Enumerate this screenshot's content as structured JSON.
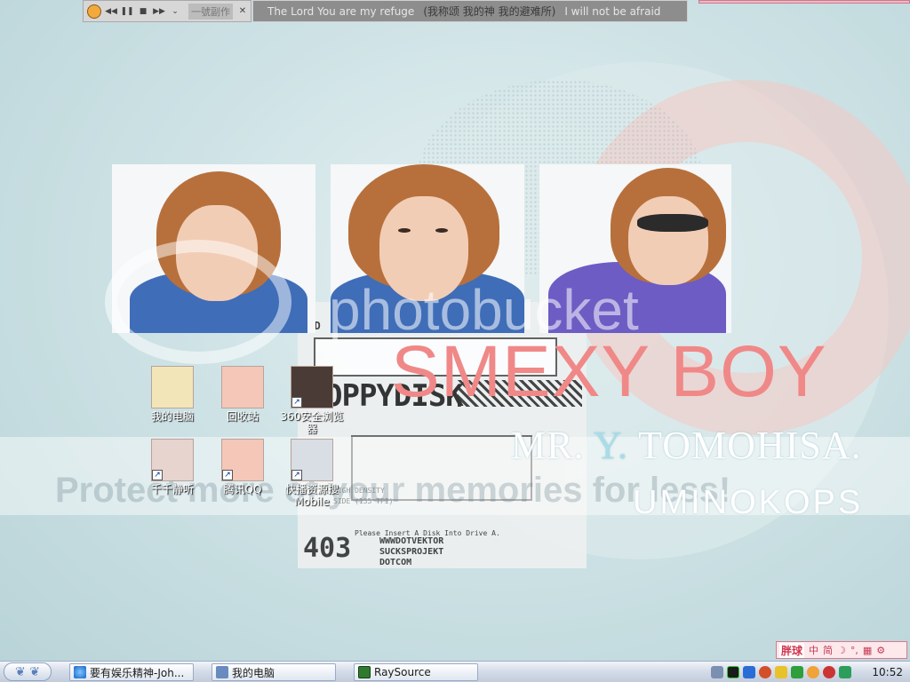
{
  "media_player": {
    "song_name": "一號副作",
    "lyric_left": "The Lord You are my refuge",
    "lyric_cn": "(我称颂 我的神 我的避难所)",
    "lyric_right": "I will not be afraid"
  },
  "wallpaper": {
    "title": "SMEXY BOY",
    "subtitle_white": "MR. ",
    "subtitle_blue": "Y. ",
    "subtitle_rest": "TOMOHISA.",
    "credit": "UMINOKOPS",
    "watermark_logo": "photobucket",
    "watermark_text": "Protect more of your memories for less!",
    "floppy_label": "OPPYDISK",
    "floppy_hd": "2HD",
    "floppy_403": "403",
    "floppy_brand_1": "WWWDOTVEKTOR",
    "floppy_brand_2": "SUCKSPROJEKT",
    "floppy_brand_3": "DOTCOM",
    "floppy_insert": "Please Insert A Disk Into Drive A.",
    "floppy_density": "HIGH DENSITY",
    "floppy_side": "SIDE (135 TPI)"
  },
  "desktop_icons": [
    {
      "label": "我的电脑"
    },
    {
      "label": "回收站"
    },
    {
      "label": "360安全浏览器"
    },
    {
      "label": "千千静听"
    },
    {
      "label": "腾讯QQ"
    },
    {
      "label": "快播资源搜Mobile"
    }
  ],
  "ime_bar": {
    "logo": "胖球",
    "items": [
      "中",
      "简",
      "☽",
      "°,",
      "▦",
      "⚙"
    ]
  },
  "taskbar": {
    "items": [
      {
        "label": "要有娱乐精神-Joh..."
      },
      {
        "label": "我的电脑"
      },
      {
        "label": "RaySource"
      }
    ],
    "clock": "10:52"
  },
  "colors": {
    "accent_pink": "#f08888",
    "taskbar": "#d3dbe8"
  }
}
